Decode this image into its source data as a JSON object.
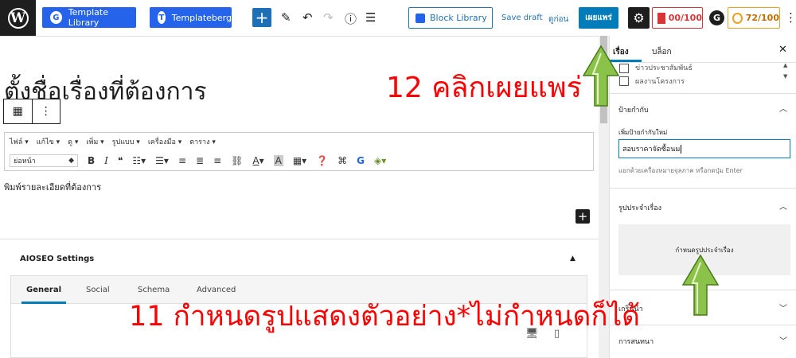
{
  "toolbar": {
    "template_library": "Template Library",
    "templateberg": "Templateberg",
    "block_library": "Block Library",
    "save_draft": "Save draft",
    "preview": "ดูก่อน",
    "publish": "เผยแพร่",
    "seo_score": "00/100",
    "truseo_score": "72/100"
  },
  "editor": {
    "title": "ตั้งชื่อเรื่องที่ต้องการ",
    "menu": [
      "ไฟล์ ▾",
      "แก้ไข ▾",
      "ดู ▾",
      "เพิ่ม ▾",
      "รูปแบบ ▾",
      "เครื่องมือ ▾",
      "ตาราง ▾"
    ],
    "format_select": "ย่อหน้า",
    "body": "พิมพ์รายละเอียดที่ต้องการ"
  },
  "aioseo": {
    "title": "AIOSEO Settings",
    "tabs": [
      "General",
      "Social",
      "Schema",
      "Advanced"
    ]
  },
  "sidebar": {
    "tab_post": "เรื่อง",
    "tab_block": "บล็อก",
    "categories": [
      "ข่าวประชาสัมพันธ์",
      "ผลงานโครงการ"
    ],
    "tags_heading": "ป้ายกำกับ",
    "tags_label": "เพิ่มป้ายกำกับใหม่",
    "tags_value": "สอบราคาจัดซื้อนม",
    "tags_help": "แยกด้วยเครื่องหมายจุลภาค หรือกดปุ่ม Enter",
    "featured_heading": "รูปประจำเรื่อง",
    "featured_button": "กำหนดรูปประจำเรื่อง",
    "excerpt_heading": "เกริ่นนำ",
    "discussion_heading": "การสนทนา"
  },
  "annotations": {
    "step12": "12 คลิกเผยแพร่",
    "step11": "11 กำหนดรูปแสดงตัวอย่าง*ไม่กำหนดก็ได้"
  },
  "colors": {
    "publish": "#007cba",
    "annotation_text": "#ff0000",
    "arrow": "#8bc34a"
  }
}
